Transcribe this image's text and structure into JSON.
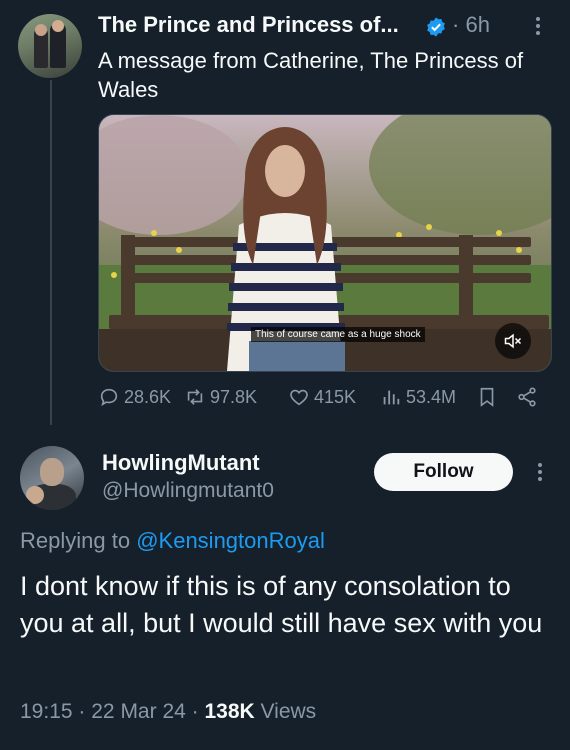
{
  "original_tweet": {
    "author_name": "The Prince and Princess of...",
    "separator": "·",
    "time": "6h",
    "text": "A message from Catherine, The Princess of Wales",
    "video_caption": "This of course came as a huge shock",
    "stats": {
      "replies": "28.6K",
      "retweets": "97.8K",
      "likes": "415K",
      "views": "53.4M"
    }
  },
  "reply": {
    "author_name": "HowlingMutant",
    "handle": "@Howlingmutant0",
    "follow_label": "Follow",
    "replying_prefix": "Replying to",
    "replying_mention": "@KensingtonRoyal",
    "text": "I dont know if this is of any consolation to you at all, but I would still have sex with you",
    "time": "19:15",
    "sep1": "·",
    "date": "22 Mar 24",
    "sep2": "·",
    "views_count": "138K",
    "views_label": "Views"
  },
  "colors": {
    "background": "#15202b",
    "text_primary": "#f7f9f9",
    "text_secondary": "#8b98a5",
    "link": "#1d9bf0",
    "verified": "#1d9bf0"
  },
  "icons": [
    "verified-badge-icon",
    "more-icon",
    "reply-icon",
    "retweet-icon",
    "like-icon",
    "views-icon",
    "bookmark-icon",
    "share-icon",
    "mute-icon"
  ]
}
